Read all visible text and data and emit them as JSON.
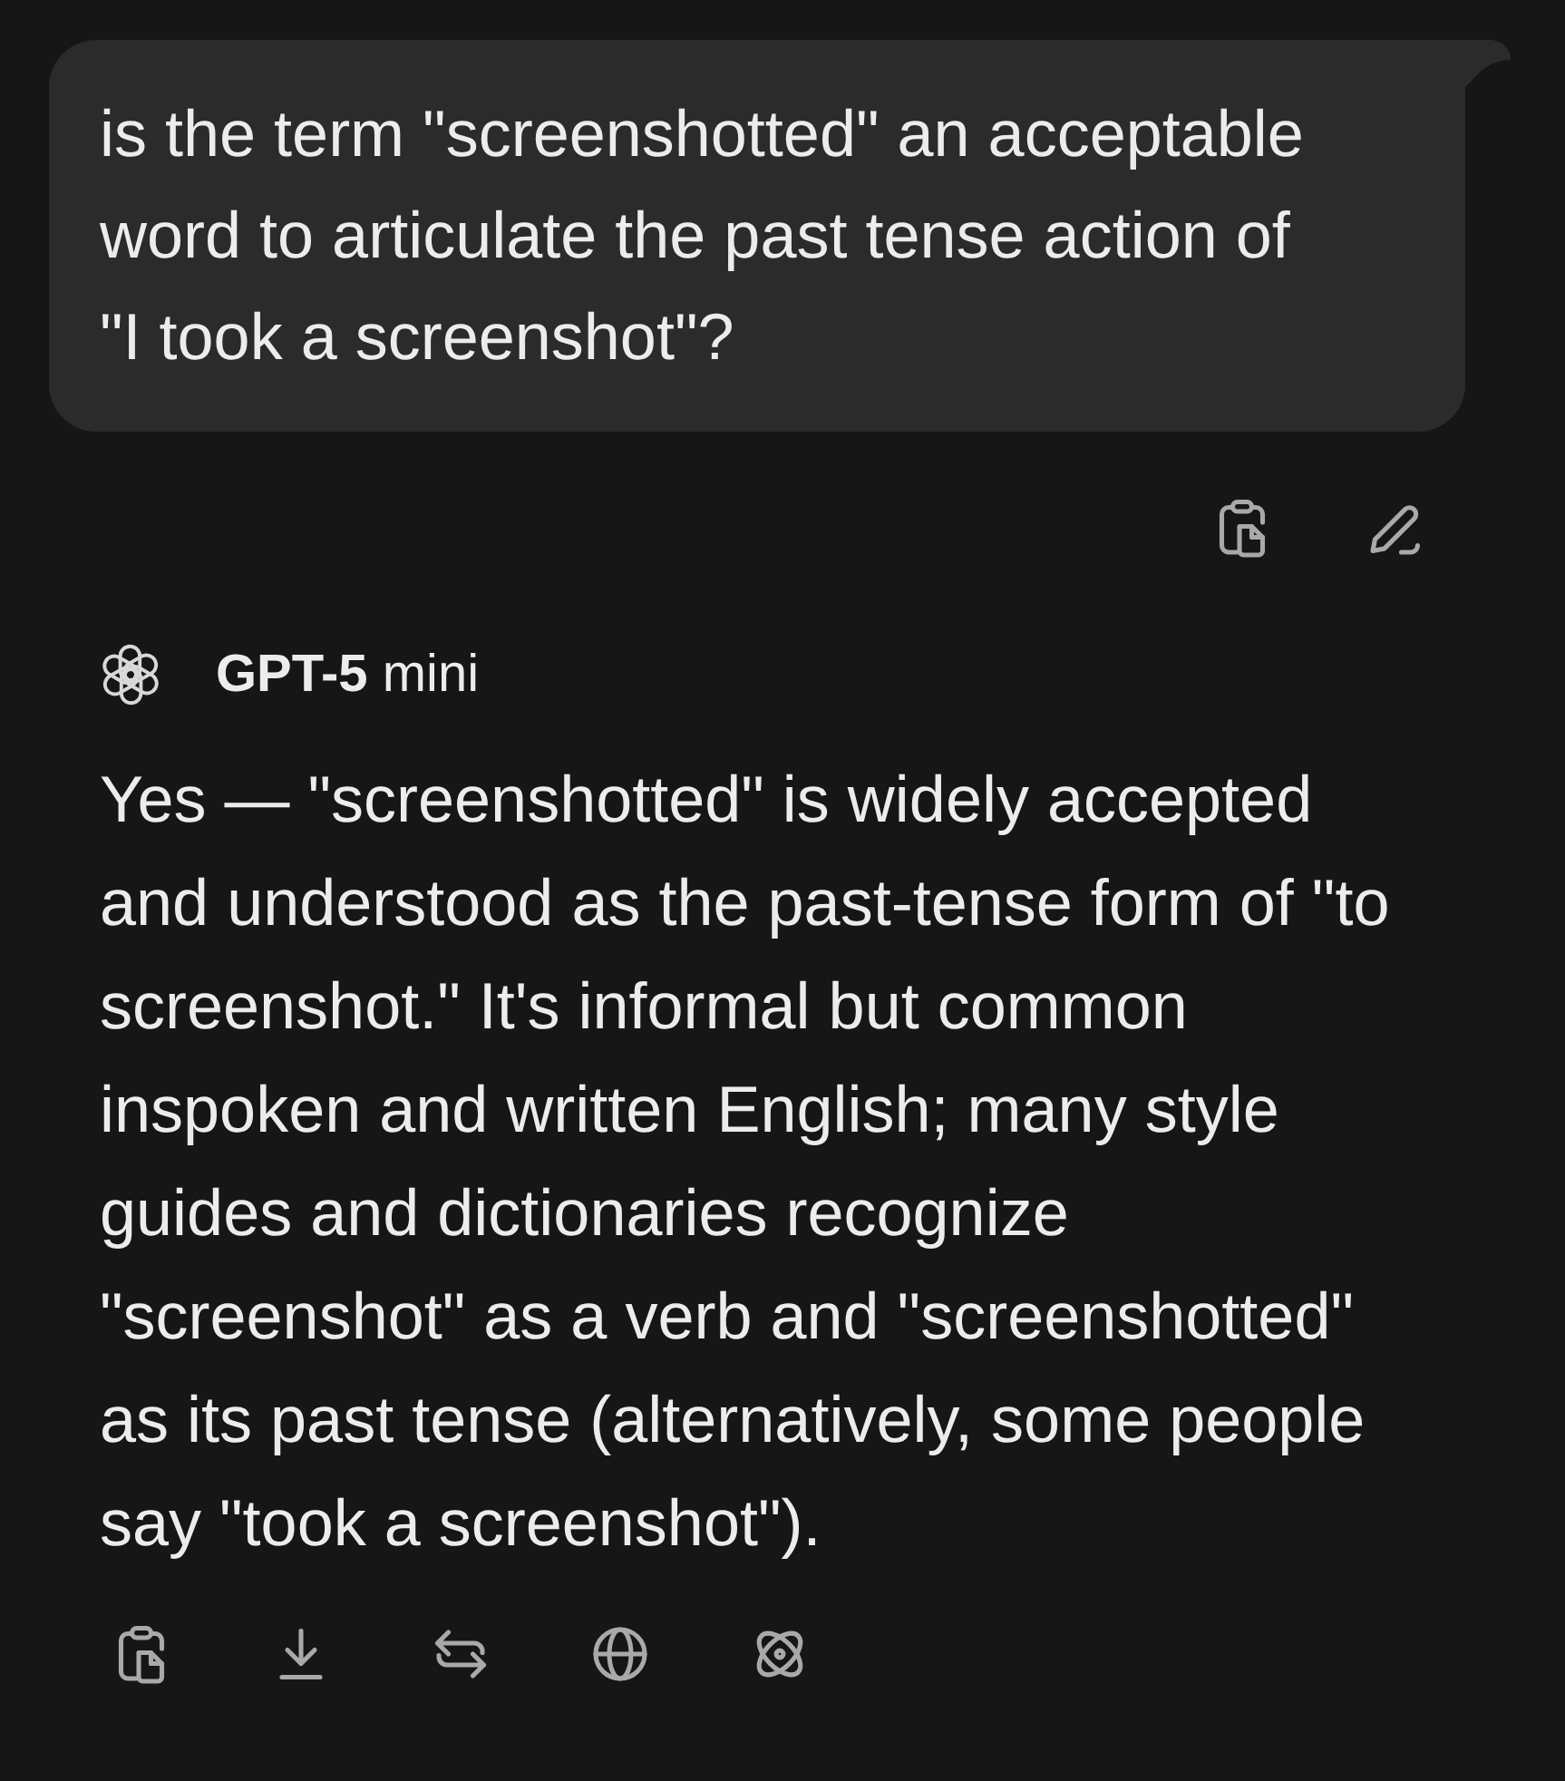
{
  "user_message": {
    "text": "is the term \"screenshotted\" an acceptable word to articulate the past tense action of \"I took a screenshot\"?"
  },
  "response": {
    "model": "**GPT-5** mini",
    "text": "Yes — \"screenshotted\" is widely accepted and understood as the past-tense form of \"to screenshot.\" It's informal but common inspoken and written English; many style guides and dictionaries recognize \"screenshot\" as a verb and \"screenshotted\" as its past tense (alternatively, some people say \"took a screenshot\")."
  }
}
